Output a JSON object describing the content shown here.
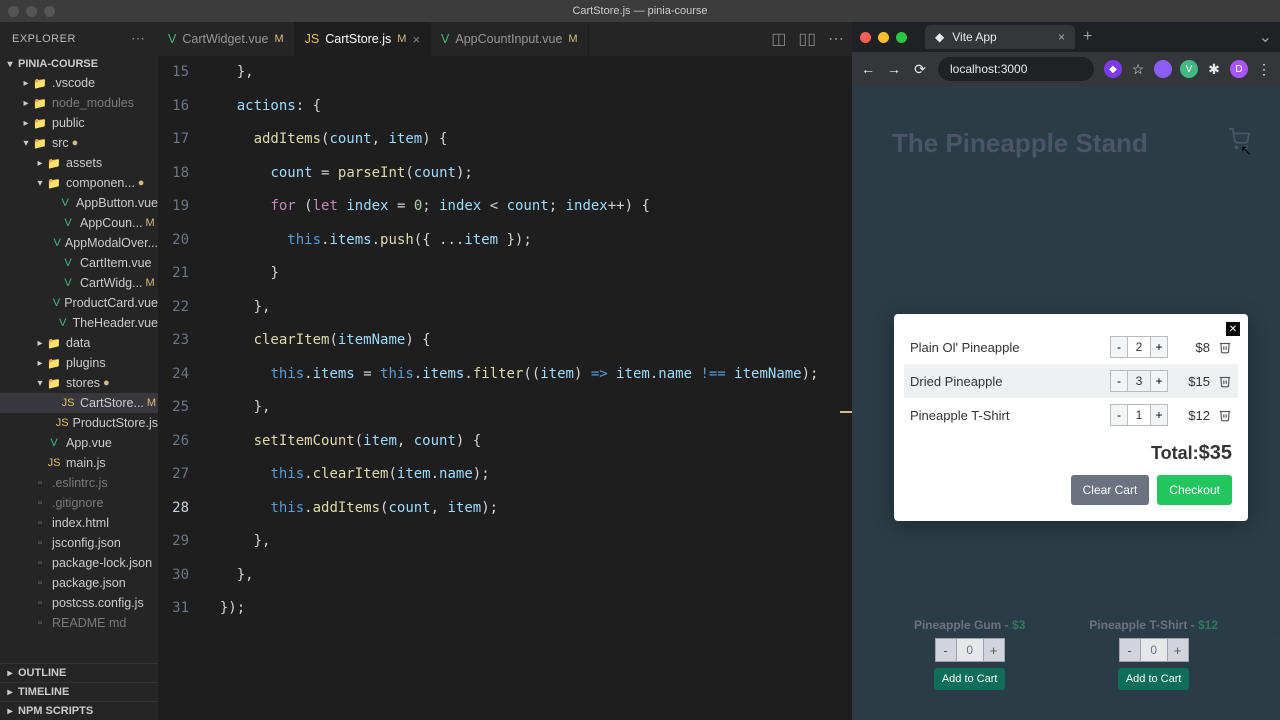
{
  "titlebar": "CartStore.js — pinia-course",
  "explorer": {
    "title": "EXPLORER",
    "project": "PINIA-COURSE",
    "tree": [
      {
        "type": "folder",
        "name": ".vscode",
        "depth": 1,
        "expanded": false
      },
      {
        "type": "folder",
        "name": "node_modules",
        "depth": 1,
        "expanded": false,
        "dim": true
      },
      {
        "type": "folder",
        "name": "public",
        "depth": 1,
        "expanded": false
      },
      {
        "type": "folder",
        "name": "src",
        "depth": 1,
        "expanded": true,
        "mod": true
      },
      {
        "type": "folder",
        "name": "assets",
        "depth": 2,
        "expanded": false
      },
      {
        "type": "folder",
        "name": "componen...",
        "depth": 2,
        "expanded": true,
        "mod": true
      },
      {
        "type": "vue",
        "name": "AppButton.vue",
        "depth": 3
      },
      {
        "type": "vue",
        "name": "AppCoun...",
        "depth": 3,
        "mod": "M"
      },
      {
        "type": "vue",
        "name": "AppModalOver...",
        "depth": 3
      },
      {
        "type": "vue",
        "name": "CartItem.vue",
        "depth": 3
      },
      {
        "type": "vue",
        "name": "CartWidg...",
        "depth": 3,
        "mod": "M"
      },
      {
        "type": "vue",
        "name": "ProductCard.vue",
        "depth": 3
      },
      {
        "type": "vue",
        "name": "TheHeader.vue",
        "depth": 3
      },
      {
        "type": "folder",
        "name": "data",
        "depth": 2,
        "expanded": false
      },
      {
        "type": "folder",
        "name": "plugins",
        "depth": 2,
        "expanded": false
      },
      {
        "type": "folder",
        "name": "stores",
        "depth": 2,
        "expanded": true,
        "mod": true
      },
      {
        "type": "js",
        "name": "CartStore...",
        "depth": 3,
        "mod": "M",
        "sel": true
      },
      {
        "type": "js",
        "name": "ProductStore.js",
        "depth": 3
      },
      {
        "type": "vue",
        "name": "App.vue",
        "depth": 2
      },
      {
        "type": "js",
        "name": "main.js",
        "depth": 2
      },
      {
        "type": "gen",
        "name": ".eslintrc.js",
        "depth": 1,
        "dim": true
      },
      {
        "type": "gen",
        "name": ".gitignore",
        "depth": 1,
        "dim": true
      },
      {
        "type": "gen",
        "name": "index.html",
        "depth": 1
      },
      {
        "type": "gen",
        "name": "jsconfig.json",
        "depth": 1
      },
      {
        "type": "gen",
        "name": "package-lock.json",
        "depth": 1
      },
      {
        "type": "gen",
        "name": "package.json",
        "depth": 1
      },
      {
        "type": "gen",
        "name": "postcss.config.js",
        "depth": 1
      },
      {
        "type": "gen",
        "name": "README md",
        "depth": 1,
        "dim": true
      }
    ],
    "outline": "OUTLINE",
    "timeline": "TIMELINE",
    "npm": "NPM SCRIPTS"
  },
  "tabs": [
    {
      "icon": "vue",
      "label": "CartWidget.vue",
      "mod": "M"
    },
    {
      "icon": "js",
      "label": "CartStore.js",
      "mod": "M",
      "active": true,
      "close": true
    },
    {
      "icon": "vue",
      "label": "AppCountInput.vue",
      "mod": "M"
    }
  ],
  "code": {
    "start": 15,
    "current": 28,
    "lines": [
      "    },",
      "",
      "    actions: {",
      "",
      "      addItems(count, item) {",
      "",
      "        count = parseInt(count);",
      "",
      "        for (let index = 0; index < count; index++) {",
      "",
      "          this.items.push({ ...item });",
      "",
      "        }",
      "",
      "      },",
      "",
      "      clearItem(itemName) {",
      "",
      "        this.items = this.items.filter((item) => item.name !== itemName);",
      "",
      "      },",
      "",
      "      setItemCount(item, count) {",
      "",
      "        this.clearItem(item.name);",
      "",
      "        this.addItems(count, item);",
      "",
      "      },",
      "",
      "    },",
      "",
      "  });"
    ]
  },
  "browser": {
    "tab_title": "Vite App",
    "url": "localhost:3000",
    "page_heading": "The Pineapple Stand",
    "products": [
      {
        "name": "Pineapple Gum",
        "price": "$3",
        "qty": "0",
        "btn": "Add to Cart"
      },
      {
        "name": "Pineapple T-Shirt",
        "price": "$12",
        "qty": "0",
        "btn": "Add to Cart"
      }
    ],
    "cart": {
      "items": [
        {
          "name": "Plain Ol' Pineapple",
          "qty": "2",
          "price": "$8"
        },
        {
          "name": "Dried Pineapple",
          "qty": "3",
          "price": "$15"
        },
        {
          "name": "Pineapple T-Shirt",
          "qty": "1",
          "price": "$12"
        }
      ],
      "total_label": "Total:",
      "total": "$35",
      "clear": "Clear Cart",
      "checkout": "Checkout"
    }
  }
}
